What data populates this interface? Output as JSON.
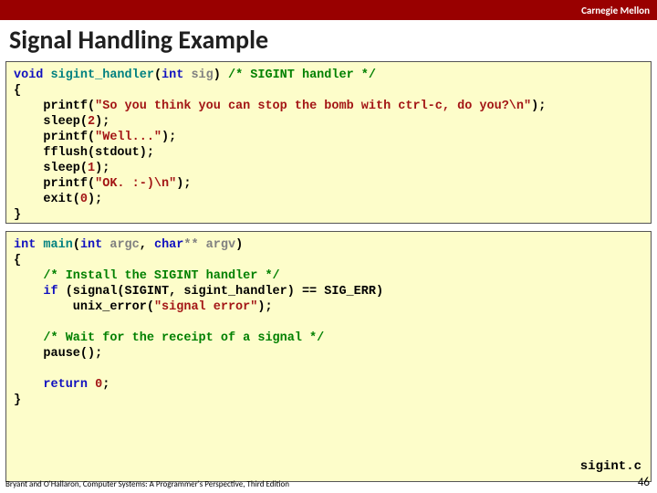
{
  "header": {
    "brand": "Carnegie Mellon",
    "title": "Signal Handling Example"
  },
  "code1": {
    "l1a": "void",
    "l1b": " sigint_handler",
    "l1c": "(",
    "l1d": "int",
    "l1e": " sig",
    "l1f": ") ",
    "l1g": "/* SIGINT handler */",
    "l2": "{",
    "l3a": "    printf(",
    "l3b": "\"So you think you can stop the bomb with ctrl-c, do you?\\n\"",
    "l3c": ");",
    "l4a": "    sleep(",
    "l4b": "2",
    "l4c": ");",
    "l5a": "    printf(",
    "l5b": "\"Well...\"",
    "l5c": ");",
    "l6": "    fflush(stdout);",
    "l7a": "    sleep(",
    "l7b": "1",
    "l7c": ");",
    "l8a": "    printf(",
    "l8b": "\"OK. :-)\\n\"",
    "l8c": ");",
    "l9a": "    exit(",
    "l9b": "0",
    "l9c": ");",
    "l10": "}"
  },
  "code2": {
    "l1a": "int",
    "l1b": " main",
    "l1c": "(",
    "l1d": "int",
    "l1e": " argc",
    "l1f": ", ",
    "l1g": "char",
    "l1h": "** argv",
    "l1i": ")",
    "l2": "{",
    "l3": "    /* Install the SIGINT handler */",
    "l4a": "    ",
    "l4b": "if",
    "l4c": " (signal(SIGINT, sigint_handler) == SIG_ERR)",
    "l5a": "        unix_error(",
    "l5b": "\"signal error\"",
    "l5c": ");",
    "l6": " ",
    "l7": "    /* Wait for the receipt of a signal */",
    "l8": "    pause();",
    "l9": " ",
    "l10a": "    ",
    "l10b": "return",
    "l10c": " ",
    "l10d": "0",
    "l10e": ";",
    "l11": "}",
    "filename": "sigint.c"
  },
  "footer": {
    "credit": "Bryant and O'Hallaron, Computer Systems: A Programmer's Perspective, Third Edition",
    "page": "46"
  }
}
